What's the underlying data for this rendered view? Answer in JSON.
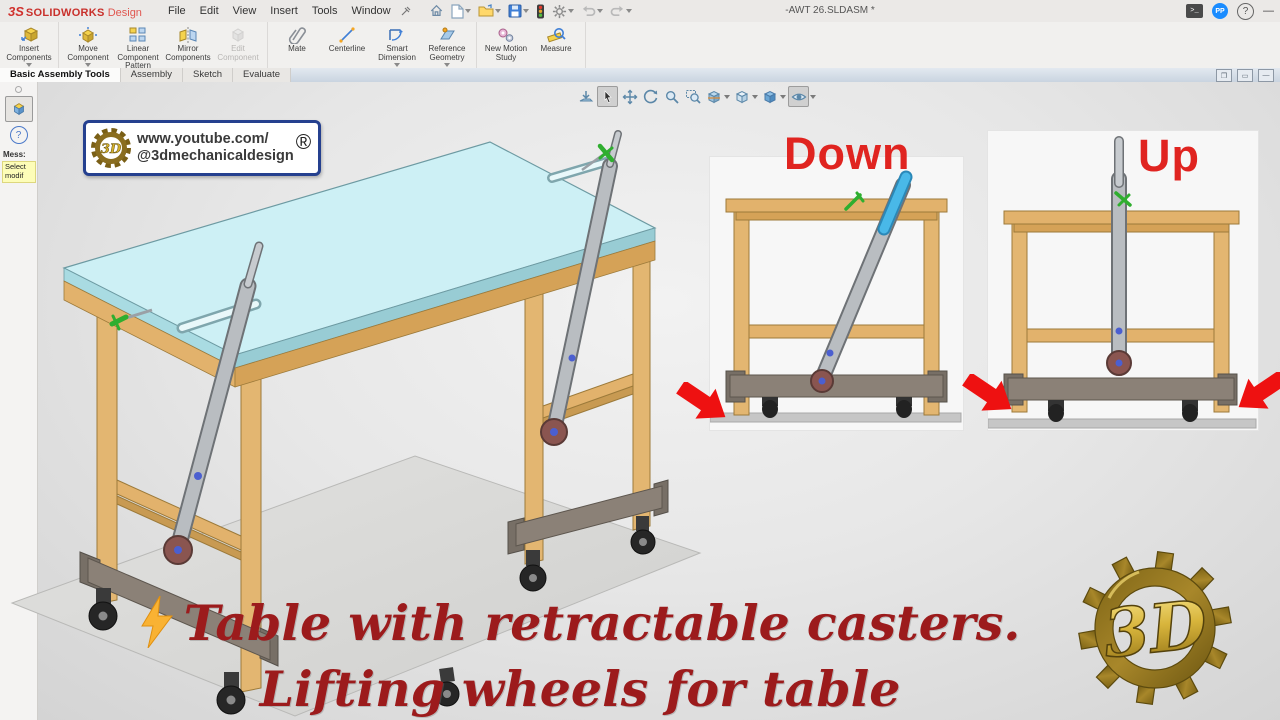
{
  "titlebar": {
    "logo_glyph": "3S",
    "brand": "SOLIDWORKS",
    "brand_suffix": "Design",
    "menus": [
      "File",
      "Edit",
      "View",
      "Insert",
      "Tools",
      "Window"
    ],
    "document_title": "-AWT 26.SLDASM *",
    "terminal_glyph": ">_",
    "user_initials": "PP",
    "help_glyph": "?",
    "minimize_glyph": "—"
  },
  "ribbon": {
    "tabs": [
      {
        "label": "Basic Assembly Tools",
        "active": true
      },
      {
        "label": "Assembly",
        "active": false
      },
      {
        "label": "Sketch",
        "active": false
      },
      {
        "label": "Evaluate",
        "active": false
      }
    ],
    "buttons": [
      {
        "label": "Insert Components"
      },
      {
        "label": "Move Component"
      },
      {
        "label": "Linear Component Pattern"
      },
      {
        "label": "Mirror Components"
      },
      {
        "label": "Edit Component"
      },
      {
        "label": "Mate"
      },
      {
        "label": "Centerline"
      },
      {
        "label": "Smart Dimension"
      },
      {
        "label": "Reference Geometry"
      },
      {
        "label": "New Motion Study"
      },
      {
        "label": "Measure"
      }
    ]
  },
  "property_panel": {
    "help_glyph": "?",
    "message_label": "Mess:",
    "note_line1": "Select",
    "note_line2": "modif"
  },
  "watermark": {
    "url_line1": "www.youtube.com/",
    "url_line2": "@3dmechanicaldesign",
    "registered": "®"
  },
  "insets": {
    "down_label": "Down",
    "up_label": "Up"
  },
  "caption": {
    "line1": "Table with retractable casters.",
    "line2": "Lifting wheels for table"
  },
  "logo3d": {
    "text": "3D"
  },
  "colors": {
    "accent_red": "#e02420",
    "caption_red": "#9c1b1c",
    "table_top": "#cdf0f5",
    "wood": "#e2b26c",
    "lever_gray": "#b9bdc1",
    "beam_gray": "#8b8177",
    "handle_blue": "#45b6ee",
    "gold": "#c9a227"
  }
}
